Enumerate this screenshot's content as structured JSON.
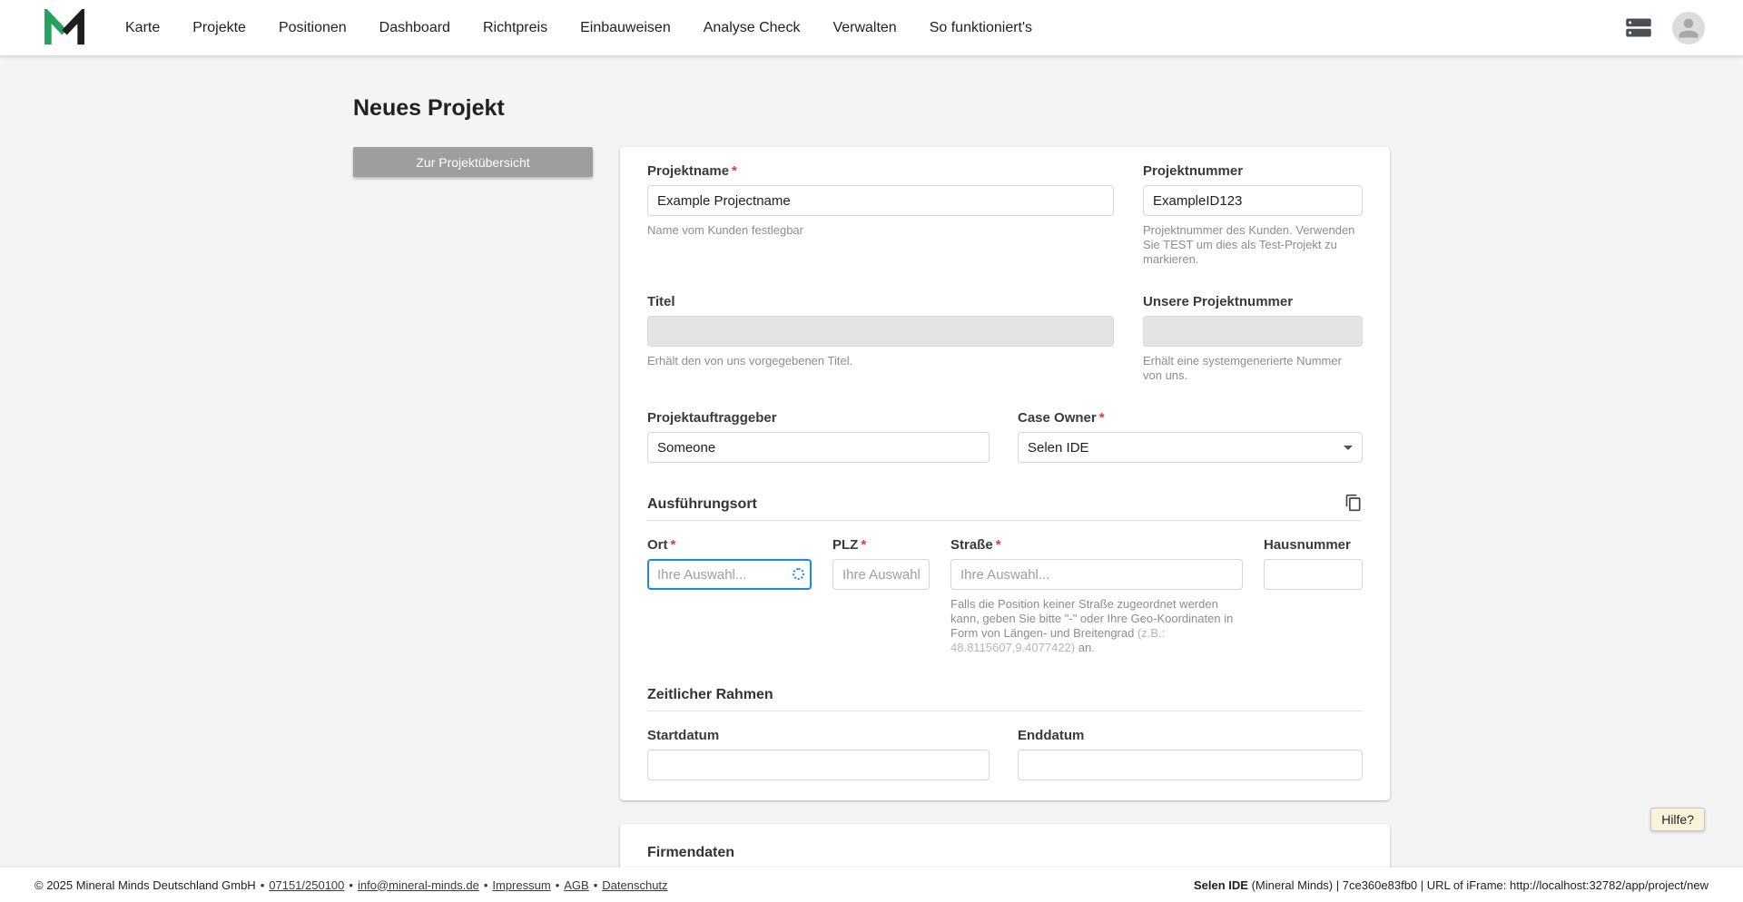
{
  "ui": {
    "required_marker": "*",
    "separator": "•"
  },
  "colors": {
    "brand_green": "#27a05d",
    "required_red": "#e53935",
    "focus_blue": "#1e88e5"
  },
  "navbar": {
    "items": [
      {
        "label": "Karte"
      },
      {
        "label": "Projekte"
      },
      {
        "label": "Positionen"
      },
      {
        "label": "Dashboard"
      },
      {
        "label": "Richtpreis"
      },
      {
        "label": "Einbauweisen"
      },
      {
        "label": "Analyse Check"
      },
      {
        "label": "Verwalten"
      },
      {
        "label": "So funktioniert's"
      }
    ]
  },
  "page": {
    "title": "Neues Projekt",
    "back_button_label": "Zur Projektübersicht"
  },
  "form": {
    "projektname": {
      "label": "Projektname",
      "value": "Example Projectname",
      "helper": "Name vom Kunden festlegbar"
    },
    "projektnummer": {
      "label": "Projektnummer",
      "value": "ExampleID123",
      "helper": "Projektnummer des Kunden. Verwenden Sie TEST um dies als Test-Projekt zu markieren."
    },
    "titel": {
      "label": "Titel",
      "value": "",
      "helper": "Erhält den von uns vorgegebenen Titel."
    },
    "unsere_projektnummer": {
      "label": "Unsere Projektnummer",
      "value": "",
      "helper": "Erhält eine systemgenerierte Nummer von uns."
    },
    "projektauftraggeber": {
      "label": "Projektauftraggeber",
      "value": "Someone"
    },
    "case_owner": {
      "label": "Case Owner",
      "value": "Selen IDE"
    },
    "ausfuehrungsort": {
      "heading": "Ausführungsort",
      "ort": {
        "label": "Ort",
        "placeholder": "Ihre Auswahl..."
      },
      "plz": {
        "label": "PLZ",
        "placeholder": "Ihre Auswahl."
      },
      "strasse": {
        "label": "Straße",
        "placeholder": "Ihre Auswahl...",
        "helper_part1": "Falls die Position keiner Straße zugeordnet werden kann, geben Sie bitte \"-\" oder Ihre Geo-Koordinaten in Form von Längen- und Breitengrad ",
        "helper_part2": "(z.B.: 48.8115607,9.4077422)",
        "helper_part3": " an."
      },
      "hausnummer": {
        "label": "Hausnummer"
      }
    },
    "zeitlicher_rahmen": {
      "heading": "Zeitlicher Rahmen",
      "startdatum_label": "Startdatum",
      "enddatum_label": "Enddatum"
    },
    "firmendaten": {
      "heading": "Firmendaten"
    }
  },
  "help_button_label": "Hilfe?",
  "footer": {
    "copyright": "© 2025 Mineral Minds Deutschland GmbH",
    "phone": "07151/250100",
    "email": "info@mineral-minds.de",
    "impressum": "Impressum",
    "agb": "AGB",
    "datenschutz": "Datenschutz",
    "user_bold": "Selen IDE",
    "user_rest": " (Mineral Minds) | 7ce360e83fb0 | URL of iFrame: http://localhost:32782/app/project/new"
  }
}
